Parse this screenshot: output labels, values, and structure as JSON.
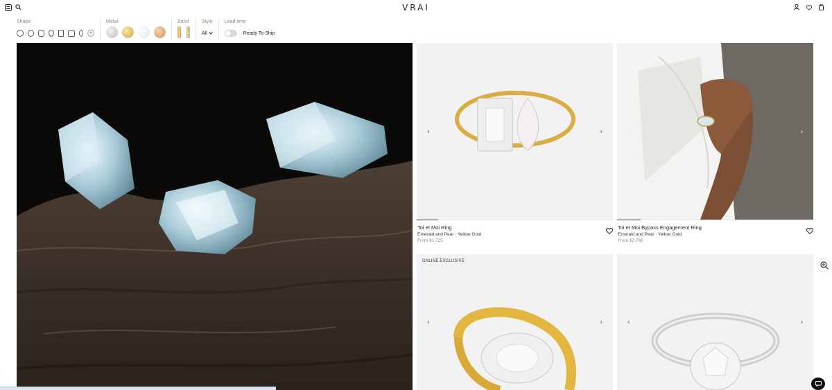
{
  "header": {
    "logo": "VRAI",
    "left_icons": [
      "menu-icon",
      "search-icon"
    ],
    "right_icons": [
      "account-icon",
      "wishlist-icon",
      "bag-icon"
    ]
  },
  "filters": {
    "shape": {
      "label": "Shape",
      "options": [
        "round",
        "oval",
        "cushion",
        "pear",
        "emerald",
        "radiant",
        "marquise",
        "more"
      ]
    },
    "metal": {
      "label": "Metal",
      "options": [
        {
          "name": "platinum",
          "color": "#c9c9c9"
        },
        {
          "name": "yellow-gold",
          "color": "#e2c26f"
        },
        {
          "name": "white-gold",
          "color": "#eeeeee"
        },
        {
          "name": "rose-gold",
          "color": "#e4b083"
        }
      ]
    },
    "band": {
      "label": "Band",
      "options": [
        "plain-band",
        "pave-band"
      ]
    },
    "style": {
      "label": "Style",
      "value": "All"
    },
    "lead_time": {
      "label": "Lead time",
      "toggle_label": "Ready To Ship",
      "on": false
    }
  },
  "products": [
    {
      "name": "Toi et Moi Ring",
      "description": "Emerald and Pear · Yellow Gold",
      "price": "From $1,725",
      "badge": "",
      "slide_progress": 0.11
    },
    {
      "name": "Toi et Moi Bypass Engagement Ring",
      "description": "Emerald and Pear · Yellow Gold",
      "price": "From $2,760",
      "badge": "",
      "slide_progress": 0.12
    },
    {
      "name": "",
      "description": "",
      "price": "",
      "badge": "ONLINE EXCLUSIVE",
      "slide_progress": 0
    },
    {
      "name": "",
      "description": "",
      "price": "",
      "badge": "",
      "slide_progress": 0
    }
  ],
  "colors": {
    "accent": "#222222",
    "muted": "#888888",
    "card_bg": "#f2f2f2"
  }
}
